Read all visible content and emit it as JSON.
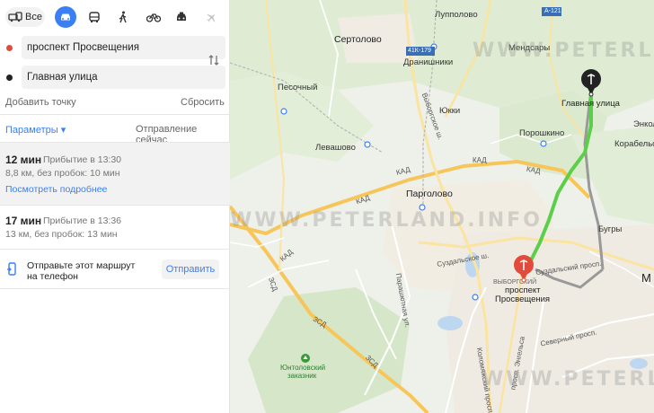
{
  "modes": {
    "all_label": "Все",
    "items": [
      {
        "name": "car-mode-button",
        "icon": "car-icon",
        "active": true
      },
      {
        "name": "transit-mode-button",
        "icon": "bus-icon",
        "active": false
      },
      {
        "name": "walk-mode-button",
        "icon": "walking-icon",
        "active": false
      },
      {
        "name": "bike-mode-button",
        "icon": "bicycle-icon",
        "active": false
      },
      {
        "name": "taxi-mode-button",
        "icon": "taxi-icon",
        "active": false
      },
      {
        "name": "plane-mode-button",
        "icon": "plane-icon",
        "active": false
      }
    ]
  },
  "route": {
    "from": "проспект Просвещения",
    "to": "Главная улица",
    "add_point": "Добавить точку",
    "reset": "Сбросить",
    "params": "Параметры",
    "depart": "Отправление сейчас"
  },
  "routes": [
    {
      "time": "12 мин",
      "arrival": "Прибытие в 13:30",
      "details": "8,8 км, без пробок: 10 мин",
      "more": "Посмотреть подробнее"
    },
    {
      "time": "17 мин",
      "arrival": "Прибытие в 13:36",
      "details": "13 км, без пробок: 13 мин"
    }
  ],
  "send": {
    "text": "Отправьте этот маршрут на телефон",
    "button": "Отправить"
  },
  "colors": {
    "accent": "#3a7ff6",
    "route_main": "#5ccf4a",
    "route_alt": "#999999",
    "start_pin": "#e24b3b",
    "end_pin": "#222222"
  },
  "map": {
    "watermark": "WWW.PETERLAND.INFO",
    "places": {
      "sertolovo": "Сертолово",
      "lupolovo": "Лупполово",
      "mendsary": "Мендсары",
      "drannishniki": "Дранишники",
      "yukki": "Юкки",
      "pesochny": "Песочный",
      "levashovo": "Левашово",
      "poroshkino": "Порошкино",
      "pargolovo": "Парголово",
      "bugry": "Бугры",
      "m_label": "М",
      "glavnaya": "Главная улица",
      "prosv": "проспект",
      "prosv2": "Просвещения",
      "vyborgsky": "ВЫБОРГСКИЙ",
      "reserve1": "Юнтоловский",
      "reserve2": "заказник",
      "korabelsk": "Корабельск",
      "enkolovo": "Энколово",
      "a121": "А-121",
      "road41k": "41К-179",
      "kad": "КАД",
      "zsd": "ЗСД",
      "suzdal": "Суздальское ш.",
      "suzdal_pr": "Суздальский просп.",
      "parashutnaya": "Парашютная ул.",
      "vyborgskoe": "Выборгское ш.",
      "engelsa": "просп. Энгельса",
      "severny": "Северный просп.",
      "kolomyazh": "Коломяжский просп."
    }
  }
}
